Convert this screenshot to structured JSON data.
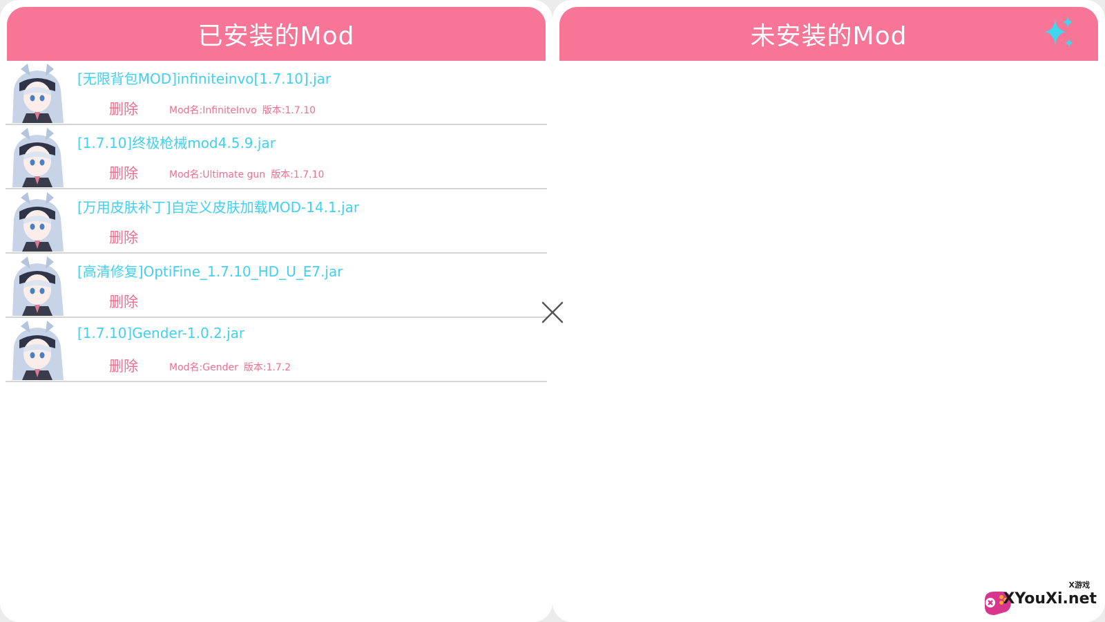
{
  "left_panel": {
    "title": "已安装的Mod",
    "mods": [
      {
        "filename": "[无限背包MOD]infiniteinvo[1.7.10].jar",
        "delete_label": "删除",
        "mod_name": "Mod名:InfiniteInvo",
        "version": "版本:1.7.10"
      },
      {
        "filename": "[1.7.10]终极枪械mod4.5.9.jar",
        "delete_label": "删除",
        "mod_name": "Mod名:Ultimate gun",
        "version": "版本:1.7.10"
      },
      {
        "filename": "[万用皮肤补丁]自定义皮肤加载MOD-14.1.jar",
        "delete_label": "删除",
        "mod_name": "",
        "version": ""
      },
      {
        "filename": "[高清修复]OptiFine_1.7.10_HD_U_E7.jar",
        "delete_label": "删除",
        "mod_name": "",
        "version": ""
      },
      {
        "filename": "[1.7.10]Gender-1.0.2.jar",
        "delete_label": "删除",
        "mod_name": "Mod名:Gender",
        "version": "版本:1.7.2"
      }
    ]
  },
  "right_panel": {
    "title": "未安装的Mod",
    "action_icon": "sparkle-icon"
  },
  "close_icon": "close-icon",
  "watermark": {
    "small_text": "X游戏",
    "big_text": "XYouXi.net"
  },
  "colors": {
    "header_pink": "#f77698",
    "filename_cyan": "#41d0f2",
    "delete_pink": "#ee6f8f",
    "sparkle_cyan": "#3fd6ee"
  }
}
